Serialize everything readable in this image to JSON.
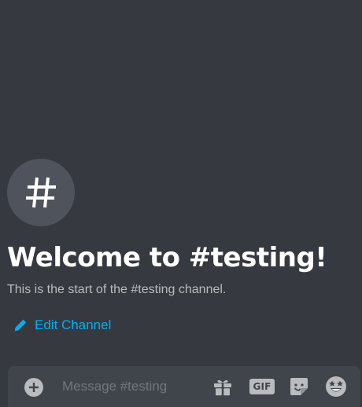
{
  "channel": {
    "symbol": "#",
    "welcome_title": "Welcome to #testing!",
    "welcome_subtitle": "This is the start of the #testing channel.",
    "edit_label": "Edit Channel"
  },
  "composer": {
    "placeholder": "Message #testing",
    "add_icon": "plus-circle-icon",
    "tools": [
      {
        "name": "gift",
        "icon": "gift-icon"
      },
      {
        "name": "gif",
        "label": "GIF"
      },
      {
        "name": "sticker",
        "icon": "sticker-icon"
      },
      {
        "name": "emoji",
        "icon": "emoji-icon"
      }
    ]
  },
  "colors": {
    "background": "#36393f",
    "composer": "#40444b",
    "accent": "#00aff4",
    "muted": "#b9bbbe",
    "placeholder": "#72767d"
  }
}
